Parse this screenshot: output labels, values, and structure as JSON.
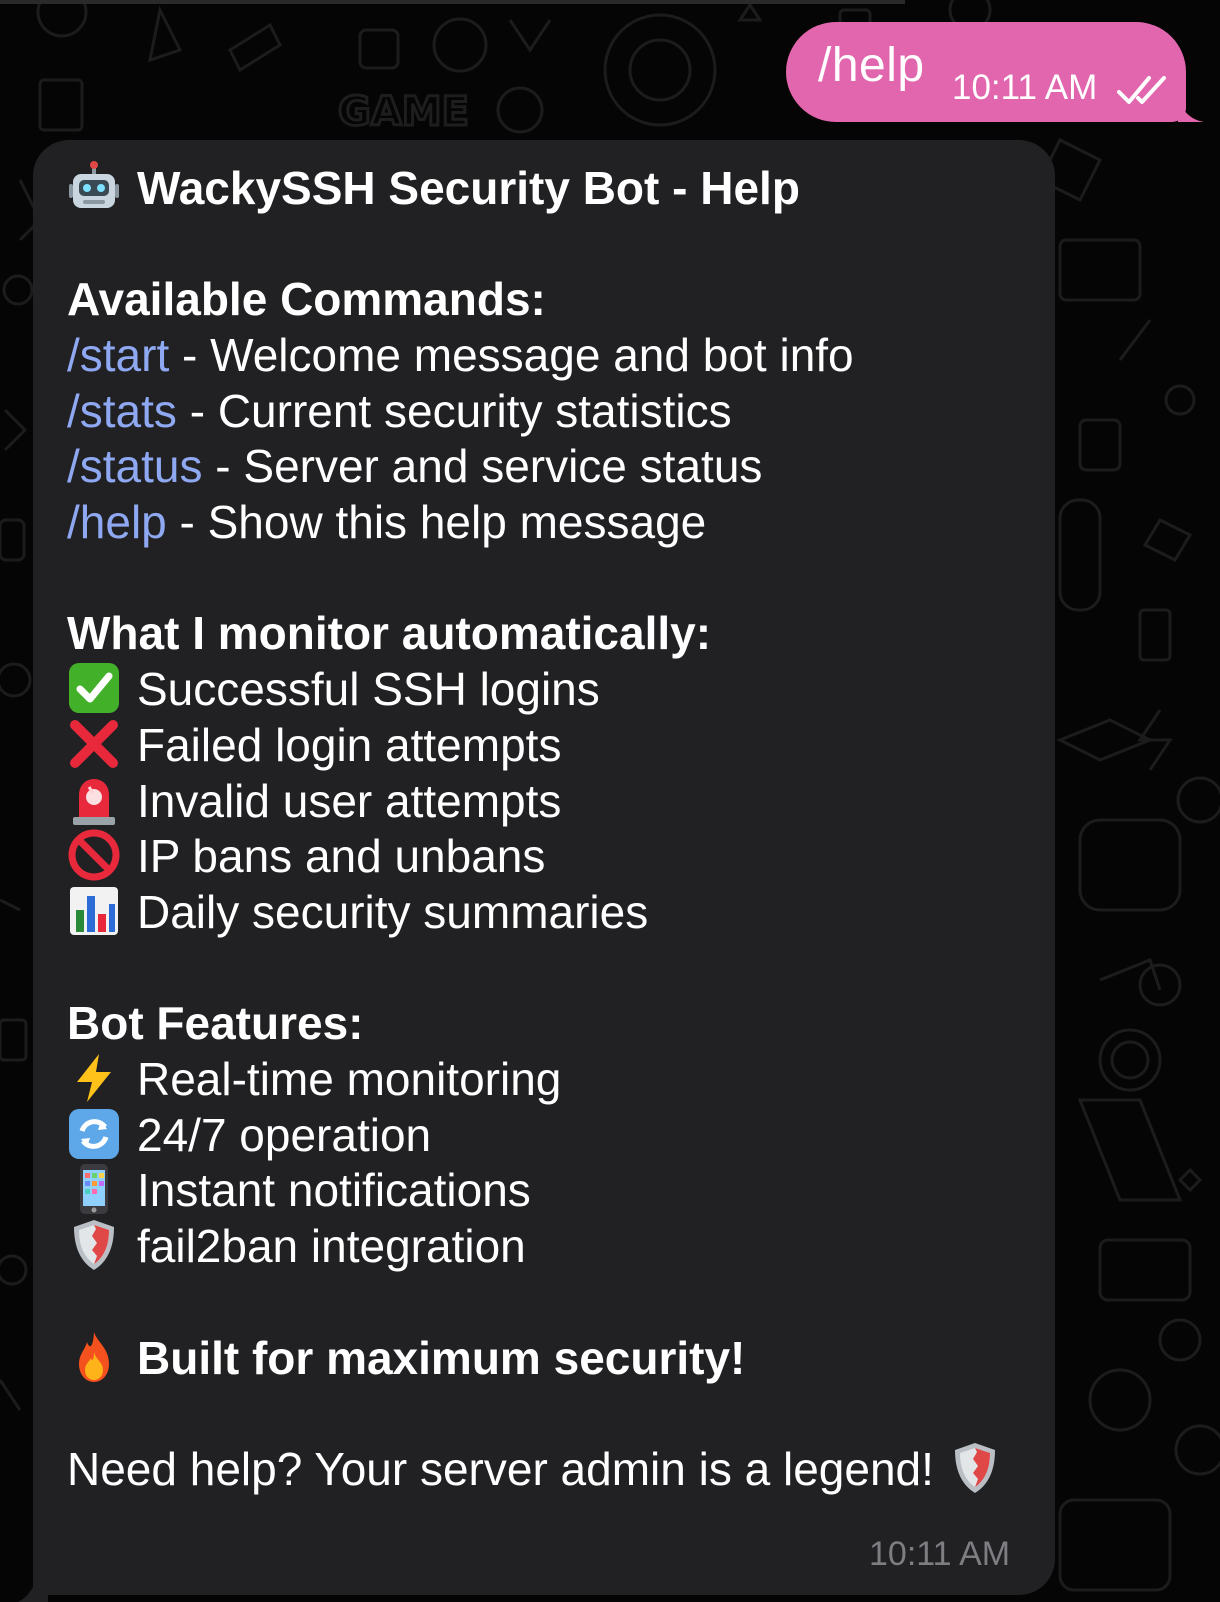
{
  "chat": {
    "outgoing": {
      "text": "/help",
      "time": "10:11 AM",
      "status_icon": "double-check-icon"
    },
    "incoming": {
      "title_icon": "robot-icon",
      "title": "WackySSH Security Bot - Help",
      "commands_heading": "Available Commands:",
      "commands": [
        {
          "cmd": "/start",
          "desc": " - Welcome message and bot info"
        },
        {
          "cmd": "/stats",
          "desc": " - Current security statistics"
        },
        {
          "cmd": "/status",
          "desc": " - Server and service status"
        },
        {
          "cmd": "/help",
          "desc": " - Show this help message"
        }
      ],
      "monitor_heading": "What I monitor automatically:",
      "monitor_items": [
        {
          "icon": "check-mark-icon",
          "text": "Successful SSH logins"
        },
        {
          "icon": "cross-mark-icon",
          "text": "Failed login attempts"
        },
        {
          "icon": "siren-icon",
          "text": "Invalid user attempts"
        },
        {
          "icon": "no-entry-icon",
          "text": "IP bans and unbans"
        },
        {
          "icon": "bar-chart-icon",
          "text": "Daily security summaries"
        }
      ],
      "features_heading": "Bot Features:",
      "features": [
        {
          "icon": "lightning-icon",
          "text": "Real-time monitoring"
        },
        {
          "icon": "refresh-icon",
          "text": "24/7 operation"
        },
        {
          "icon": "phone-icon",
          "text": "Instant notifications"
        },
        {
          "icon": "shield-icon",
          "text": "fail2ban integration"
        }
      ],
      "closing_icon": "fire-icon",
      "closing": "Built for maximum security!",
      "footer": "Need help? Your server admin is a legend!",
      "footer_icon": "shield-icon",
      "time": "10:11 AM"
    }
  },
  "colors": {
    "background": "#050505",
    "outgoing_bubble": "#e266ad",
    "incoming_bubble": "#212123",
    "command_link": "#8fa8f2",
    "timestamp": "#7d7d82"
  }
}
